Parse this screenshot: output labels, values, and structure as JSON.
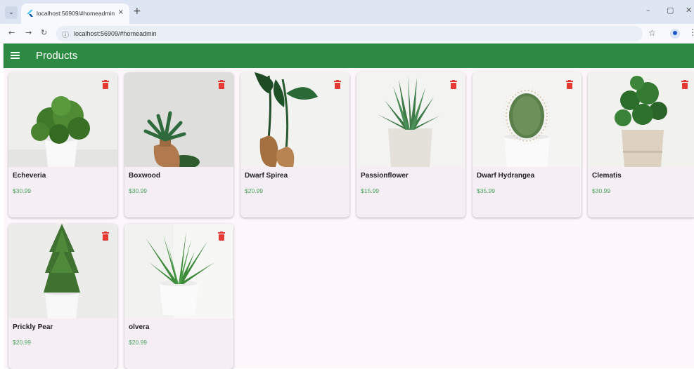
{
  "browser": {
    "tab_title": "localhost:56909/#homeadmin",
    "tab_close": "×",
    "new_tab": "+",
    "url": "localhost:56909/#homeadmin",
    "tab_menu_icon": "chevron-down-icon",
    "minimize": "–",
    "maximize": "▢",
    "close": "✕",
    "back": "←",
    "forward": "→",
    "reload": "↻",
    "info": "ⓘ",
    "star": "☆",
    "kebab": "⋮"
  },
  "appbar": {
    "title": "Products",
    "color": "#2c8a42"
  },
  "products": [
    {
      "name": "Echeveria",
      "price": "$30.99"
    },
    {
      "name": "Boxwood",
      "price": "$30.99"
    },
    {
      "name": "Dwarf Spirea",
      "price": "$20.99"
    },
    {
      "name": "Passionflower",
      "price": "$15.99"
    },
    {
      "name": "Dwarf Hydrangea",
      "price": "$35.99"
    },
    {
      "name": "Clematis",
      "price": "$30.99"
    },
    {
      "name": "Prickly Pear",
      "price": "$20.99"
    },
    {
      "name": "olvera",
      "price": "$20.99"
    }
  ],
  "colors": {
    "price": "#4aa35b",
    "delete": "#e53935",
    "card_bg": "#f5eef5"
  }
}
